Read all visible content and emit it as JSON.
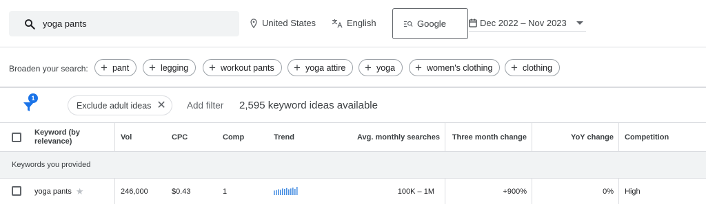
{
  "search": {
    "query": "yoga pants",
    "location": "United States",
    "language": "English",
    "engine": "Google",
    "date_range": "Dec 2022 – Nov 2023"
  },
  "broaden": {
    "label": "Broaden your search:",
    "chips": [
      "pant",
      "legging",
      "workout pants",
      "yoga attire",
      "yoga",
      "women's clothing",
      "clothing"
    ]
  },
  "filters": {
    "badge_count": "1",
    "chip_label": "Exclude adult ideas",
    "add_filter": "Add filter",
    "ideas_count": "2,595 keyword ideas available"
  },
  "table": {
    "headers": [
      "Keyword (by relevance)",
      "Vol",
      "CPC",
      "Comp",
      "Trend",
      "Avg. monthly searches",
      "Three month change",
      "YoY change",
      "Competition"
    ],
    "group_label": "Keywords you provided",
    "rows": [
      {
        "keyword": "yoga pants",
        "vol": "246,000",
        "cpc": "$0.43",
        "comp": "1",
        "avg_monthly": "100K – 1M",
        "three_month": "+900%",
        "yoy": "0%",
        "competition": "High",
        "trend": [
          0.55,
          0.6,
          0.7,
          0.65,
          0.8,
          0.75,
          0.85,
          0.7,
          0.8,
          0.9,
          0.75,
          1.0
        ]
      }
    ]
  },
  "colors": {
    "accent": "#1a73e8",
    "sparkline": "#4a90e2"
  }
}
